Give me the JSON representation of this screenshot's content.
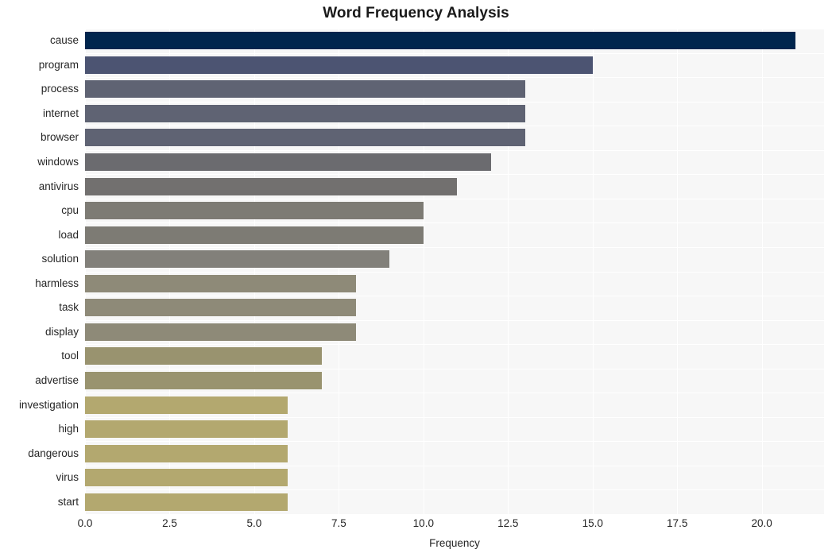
{
  "chart_data": {
    "type": "bar",
    "orientation": "horizontal",
    "title": "Word Frequency Analysis",
    "xlabel": "Frequency",
    "ylabel": "",
    "xlim": [
      0,
      21.84
    ],
    "xticks": [
      0.0,
      2.5,
      5.0,
      7.5,
      10.0,
      12.5,
      15.0,
      17.5,
      20.0
    ],
    "xtick_labels": [
      "0.0",
      "2.5",
      "5.0",
      "7.5",
      "10.0",
      "12.5",
      "15.0",
      "17.5",
      "20.0"
    ],
    "categories": [
      "cause",
      "program",
      "process",
      "internet",
      "browser",
      "windows",
      "antivirus",
      "cpu",
      "load",
      "solution",
      "harmless",
      "task",
      "display",
      "tool",
      "advertise",
      "investigation",
      "high",
      "dangerous",
      "virus",
      "start"
    ],
    "values": [
      21,
      15,
      13,
      13,
      13,
      12,
      11,
      10,
      10,
      9,
      8,
      8,
      8,
      7,
      7,
      6,
      6,
      6,
      6,
      6
    ],
    "bar_colors": [
      "#00254d",
      "#4c5472",
      "#5f6373",
      "#5f6373",
      "#5f6373",
      "#6b6b6f",
      "#72706f",
      "#7d7b74",
      "#7d7b74",
      "#82807a",
      "#8e8a78",
      "#8e8a78",
      "#8e8a78",
      "#99936f",
      "#99936f",
      "#b3a86f",
      "#b3a86f",
      "#b3a86f",
      "#b3a86f",
      "#b3a86f"
    ],
    "grid": true,
    "grid_color": "#ffffff",
    "plot_background": "#f7f7f7",
    "legend": null
  }
}
